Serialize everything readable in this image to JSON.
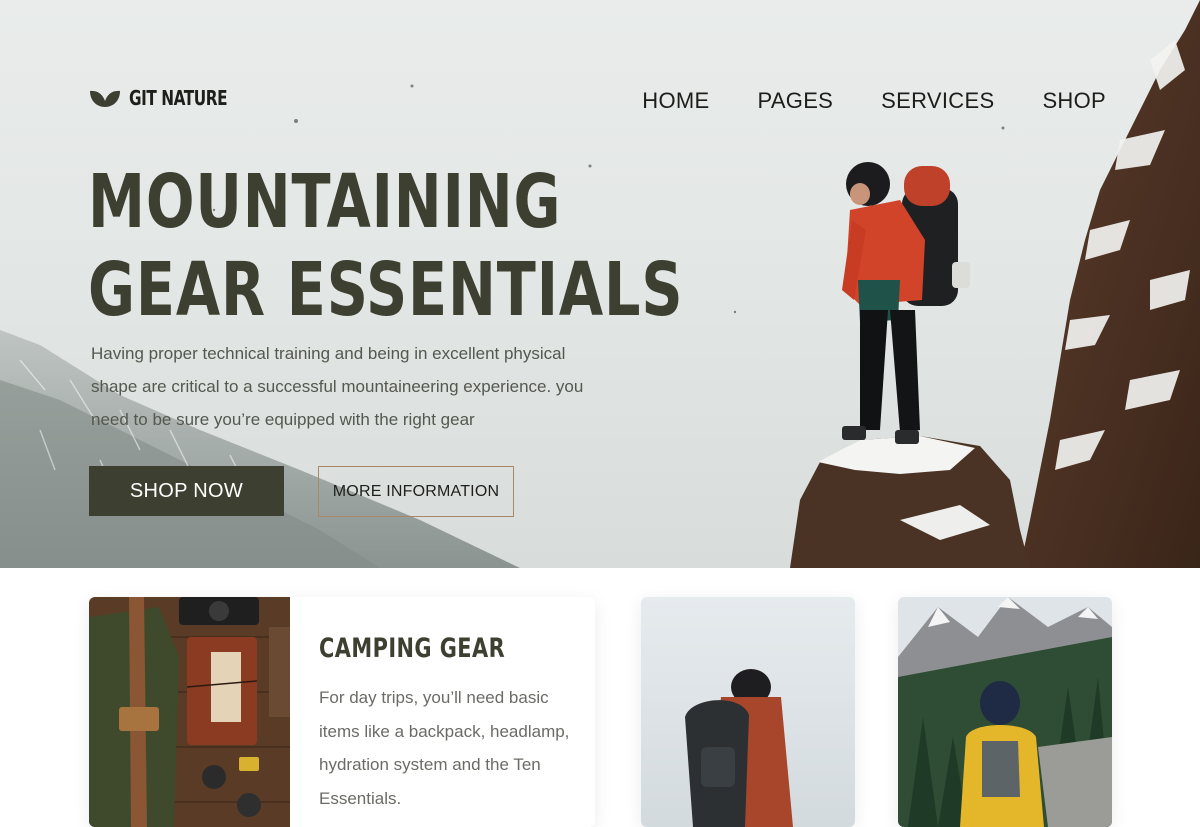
{
  "brand": {
    "name": "GIT NATURE",
    "icon": "leaf-icon",
    "color": "#1e1f1b"
  },
  "nav": {
    "items": [
      {
        "label": "HOME"
      },
      {
        "label": "PAGES"
      },
      {
        "label": "SERVICES"
      },
      {
        "label": "SHOP"
      }
    ]
  },
  "hero": {
    "title_line_1": "MOUNTAINING",
    "title_line_2": "GEAR ESSENTIALS",
    "description": "Having proper technical training and being in excellent physical shape are critical to a successful mountaineering experience. you need to be sure you’re equipped with the right gear",
    "primary_button": "SHOP NOW",
    "secondary_button": "MORE INFORMATION",
    "image": "hiker-on-snowy-cliff-photo"
  },
  "cards": [
    {
      "title": "CAMPING GEAR",
      "text": "For day trips, you’ll need basic items like a backpack, headlamp, hydration system and the Ten Essentials.",
      "image": "camping-gear-flatlay-photo"
    },
    {
      "image": "hiker-backpack-photo"
    },
    {
      "image": "hiker-mountain-view-photo"
    }
  ],
  "colors": {
    "accent": "#3d4030",
    "button_border": "#a8876a",
    "text_muted": "#55584f"
  }
}
